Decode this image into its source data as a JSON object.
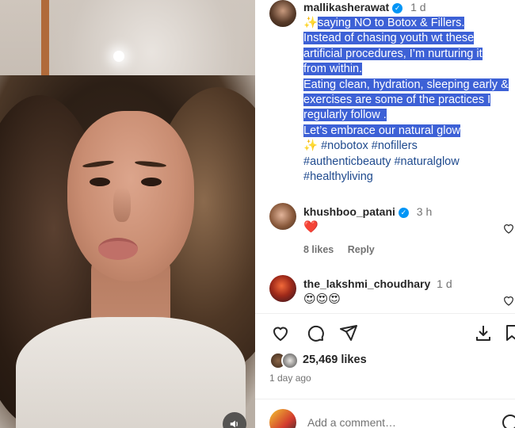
{
  "post": {
    "username": "mallikasherawat",
    "time": "1 d",
    "caption": {
      "spark": "✨",
      "highlighted_lines": [
        "saying NO to Botox & Fillers.",
        "Instead of chasing youth wt these",
        "artificial procedures, I’m nurturing it",
        "from within.",
        "Eating clean, hydration, sleeping early &",
        "exercises are some of the practices I",
        "regularly follow .",
        "Let’s embrace our natural glow"
      ],
      "hashtag_lines": [
        "#nobotox #nofillers",
        "#authenticbeauty #naturalglow",
        "#healthyliving"
      ]
    },
    "likes": "25,469 likes",
    "posted_ago": "1 day ago",
    "add_comment_placeholder": "Add a comment…"
  },
  "comments": [
    {
      "username": "khushboo_patani",
      "time": "3 h",
      "text": "❤️",
      "likes": "8 likes",
      "reply": "Reply"
    },
    {
      "username": "the_lakshmi_choudhary",
      "time": "1 d",
      "text": "😍😍😍"
    }
  ],
  "icons": {
    "like": "heart-icon",
    "comment": "comment-icon",
    "share": "share-icon",
    "save": "save-icon",
    "mute": "sound-icon"
  },
  "colors": {
    "highlight": "#3d61d6",
    "hashtag": "#1f4a8e",
    "verified": "#0095f6"
  }
}
